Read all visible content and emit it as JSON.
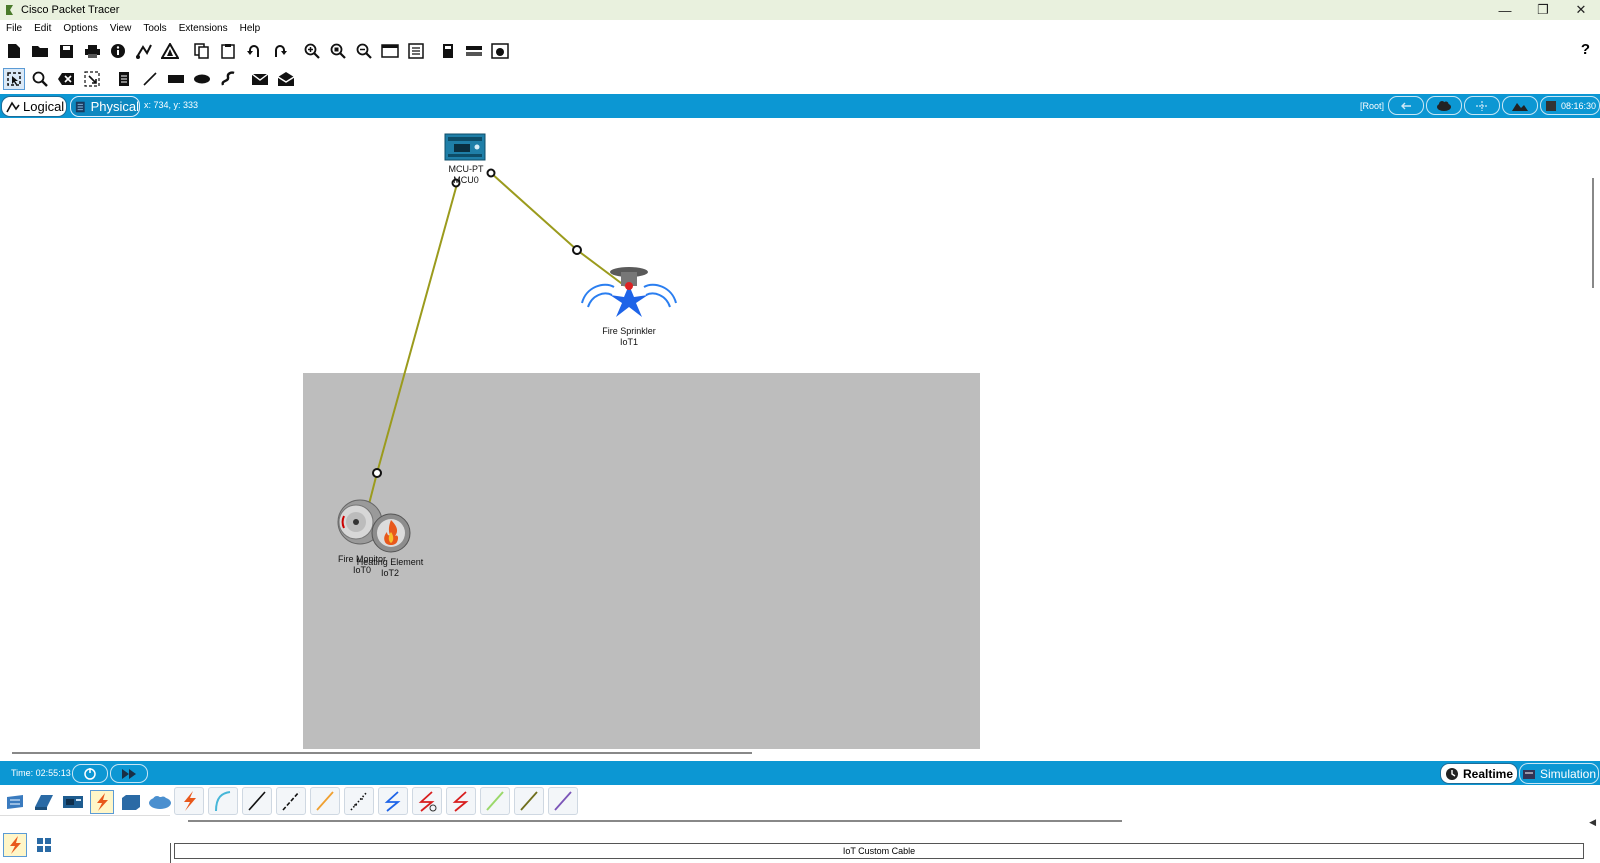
{
  "window": {
    "title": "Cisco Packet Tracer"
  },
  "menu": [
    "File",
    "Edit",
    "Options",
    "View",
    "Tools",
    "Extensions",
    "Help"
  ],
  "toolbar": {
    "icons": [
      "new-file-icon",
      "open-folder-icon",
      "save-icon",
      "print-icon",
      "info-icon",
      "activity-wizard-icon",
      "pdu-icon",
      "copy-icon",
      "paste-icon",
      "undo-icon",
      "redo-icon",
      "zoom-in-icon",
      "zoom-reset-icon",
      "zoom-out-icon",
      "drawing-palette-icon",
      "custom-device-icon",
      "viewport-icon",
      "cluster-icon",
      "screenshot-icon"
    ],
    "help_label": "?"
  },
  "tools": [
    "select-icon",
    "inspect-icon",
    "delete-icon",
    "resize-icon",
    "note-icon",
    "line-icon",
    "rectangle-icon",
    "ellipse-icon",
    "freeform-icon",
    "simple-pdu-icon",
    "complex-pdu-icon"
  ],
  "workspace_bar": {
    "logical_label": "Logical",
    "physical_label": "Physical",
    "coordinates": "x: 734, y: 333",
    "root_label": "[Root]",
    "clock": "08:16:30"
  },
  "devices": [
    {
      "name": "MCU-PT",
      "id": "MCU0"
    },
    {
      "name": "Fire Sprinkler",
      "id": "IoT1"
    },
    {
      "name": "Fire Monitor",
      "id": "IoT0"
    },
    {
      "name": "Heating Element",
      "id": "IoT2"
    }
  ],
  "timebar": {
    "time": "Time: 02:55:13",
    "realtime_label": "Realtime",
    "simulation_label": "Simulation"
  },
  "bottom": {
    "selected_cable_name": "IoT Custom Cable"
  },
  "colors": {
    "accent_bar": "#0c97d3",
    "cable_color": "#9b9b1d",
    "cluster_bg": "#bdbdbd",
    "titlebar_bg": "#e9f1de"
  }
}
